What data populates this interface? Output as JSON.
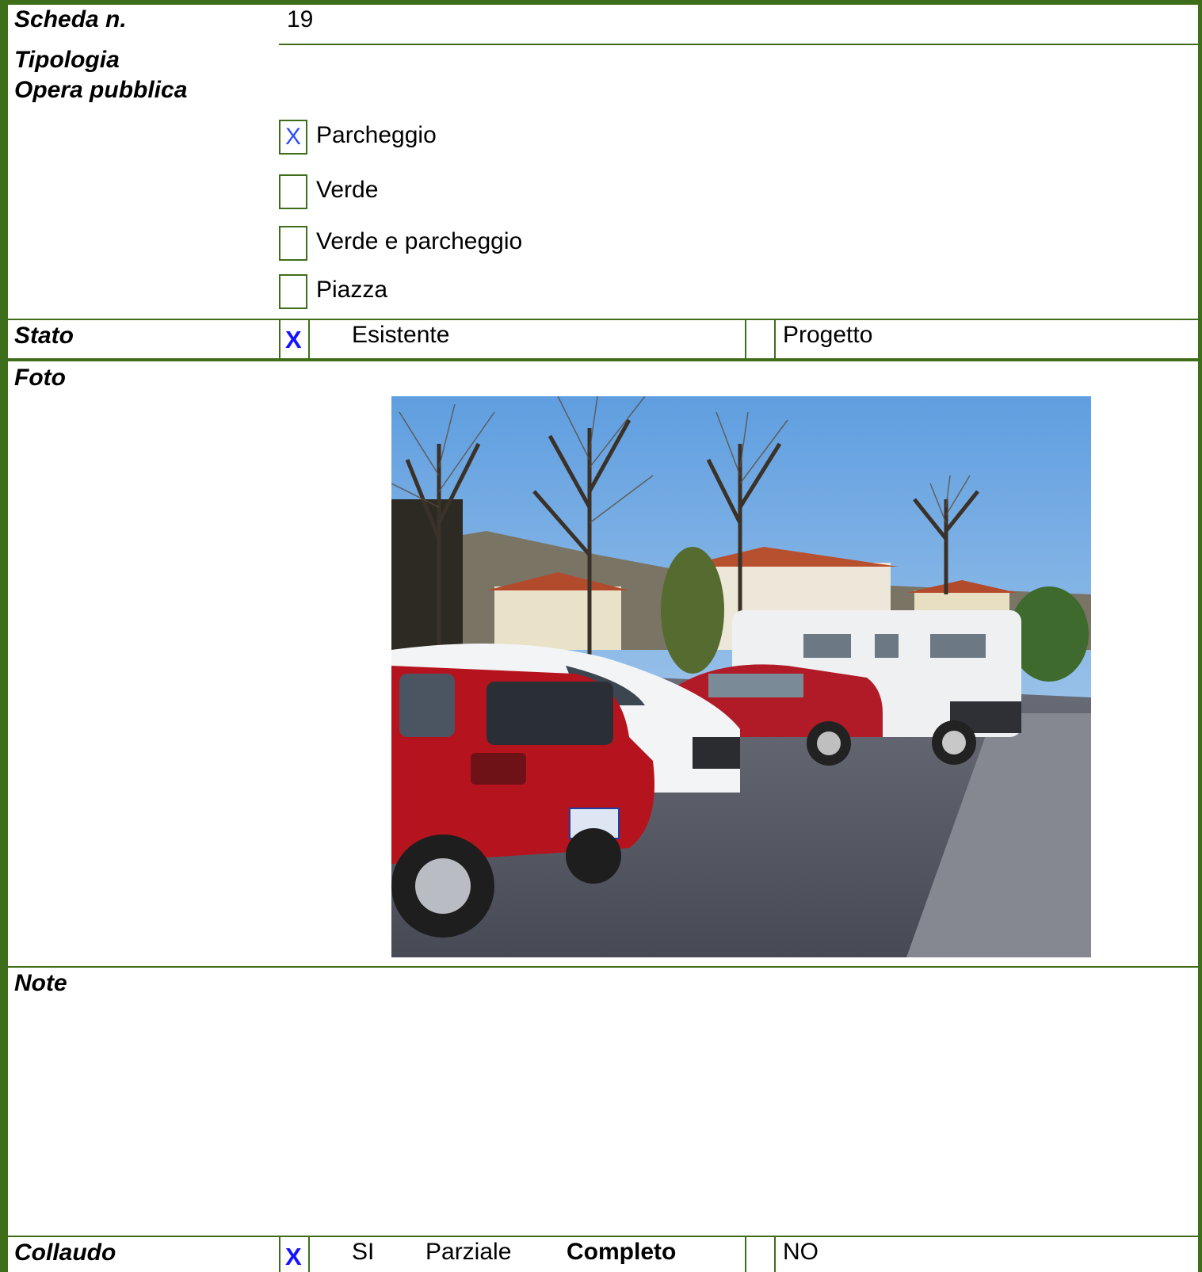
{
  "scheda": {
    "label": "Scheda n.",
    "value": "19"
  },
  "tipologia": {
    "label_line1": "Tipologia",
    "label_line2": "Opera pubblica",
    "options": [
      {
        "label": "Parcheggio",
        "mark": "X"
      },
      {
        "label": "Verde",
        "mark": ""
      },
      {
        "label": "Verde e parcheggio",
        "mark": ""
      },
      {
        "label": "Piazza",
        "mark": ""
      }
    ]
  },
  "stato": {
    "label": "Stato",
    "mark": "X",
    "option1": "Esistente",
    "option2": "Progetto"
  },
  "foto": {
    "label": "Foto"
  },
  "note": {
    "label": "Note"
  },
  "collaudo": {
    "label": "Collaudo",
    "mark": "X",
    "si": "SI",
    "parziale": "Parziale",
    "completo": "Completo",
    "no": "NO"
  },
  "colors": {
    "border": "#3f6e1a",
    "mark": "#1414ff"
  }
}
